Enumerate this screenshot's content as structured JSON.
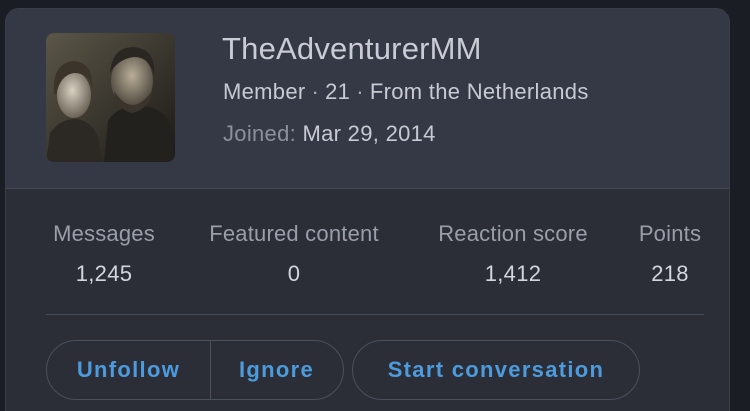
{
  "profile": {
    "username": "TheAdventurerMM",
    "role": "Member",
    "age": "21",
    "location": "From the Netherlands",
    "separator": "·",
    "joined_label": "Joined:",
    "joined_date": "Mar 29, 2014"
  },
  "stats": [
    {
      "label": "Messages",
      "value": "1,245"
    },
    {
      "label": "Featured content",
      "value": "0"
    },
    {
      "label": "Reaction score",
      "value": "1,412"
    },
    {
      "label": "Points",
      "value": "218"
    }
  ],
  "actions": {
    "unfollow": "Unfollow",
    "ignore": "Ignore",
    "start_conversation": "Start conversation"
  },
  "colors": {
    "card_bg": "#2b2e37",
    "header_bg": "#353945",
    "accent": "#4d9bdc",
    "text_primary": "#c9ccd4",
    "text_muted": "#9a9ea9"
  }
}
